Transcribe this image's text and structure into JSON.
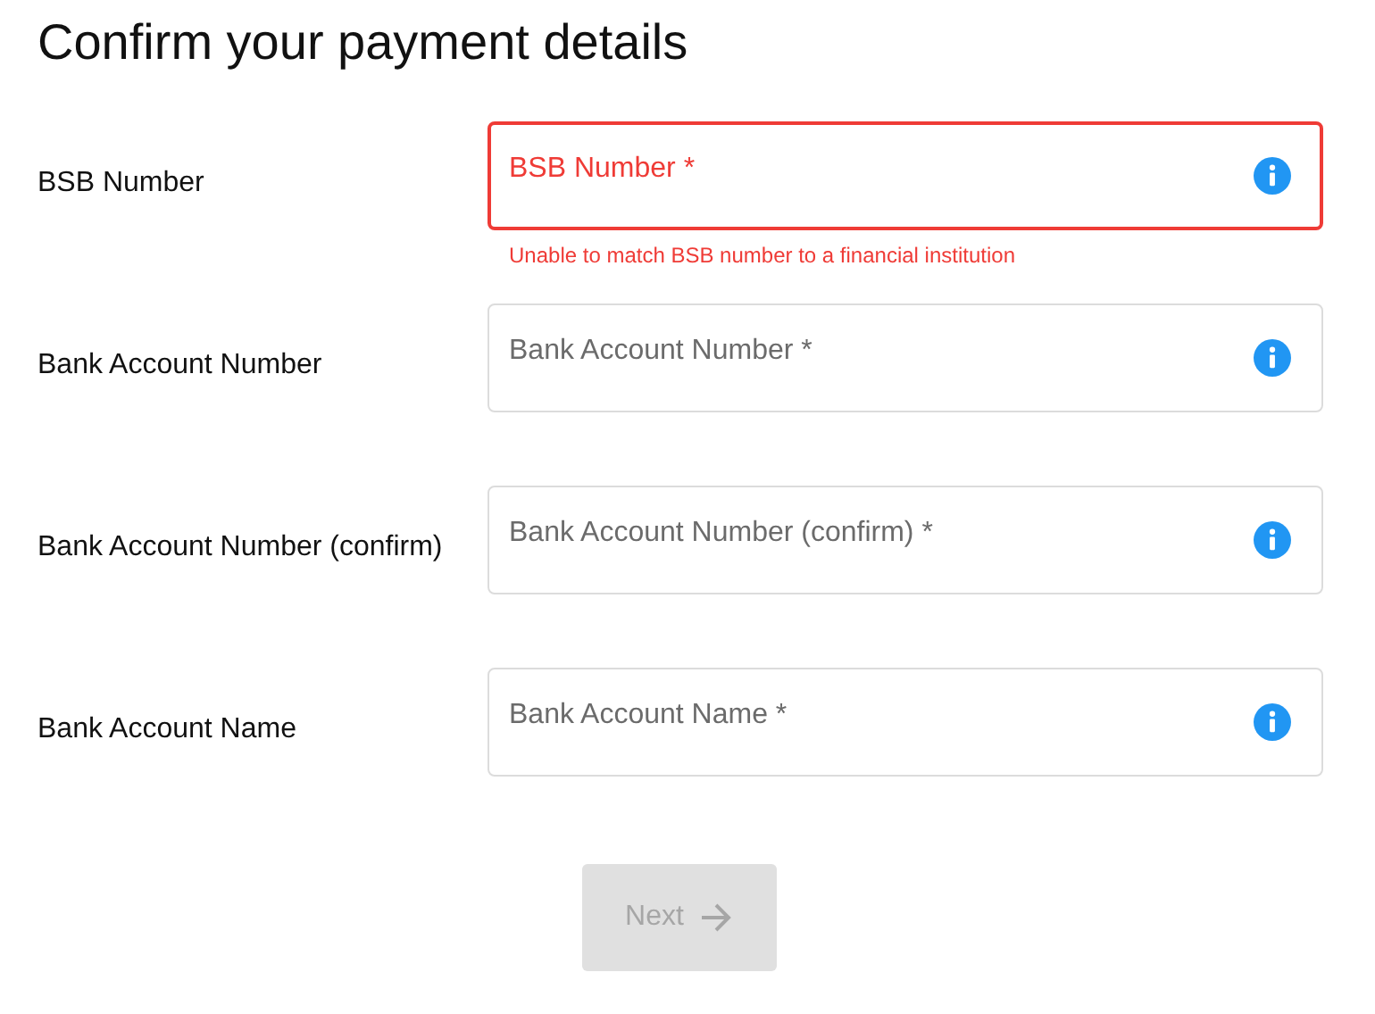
{
  "title": "Confirm your payment details",
  "fields": [
    {
      "label": "BSB Number",
      "placeholder": "BSB Number *",
      "error": true,
      "error_message": "Unable to match BSB number to a financial institution"
    },
    {
      "label": "Bank Account Number",
      "placeholder": "Bank Account Number *",
      "error": false
    },
    {
      "label": "Bank Account Number (confirm)",
      "placeholder": "Bank Account Number (confirm) *",
      "error": false
    },
    {
      "label": "Bank Account Name",
      "placeholder": "Bank Account Name *",
      "error": false
    }
  ],
  "next_button": {
    "label": "Next",
    "disabled": true
  }
}
